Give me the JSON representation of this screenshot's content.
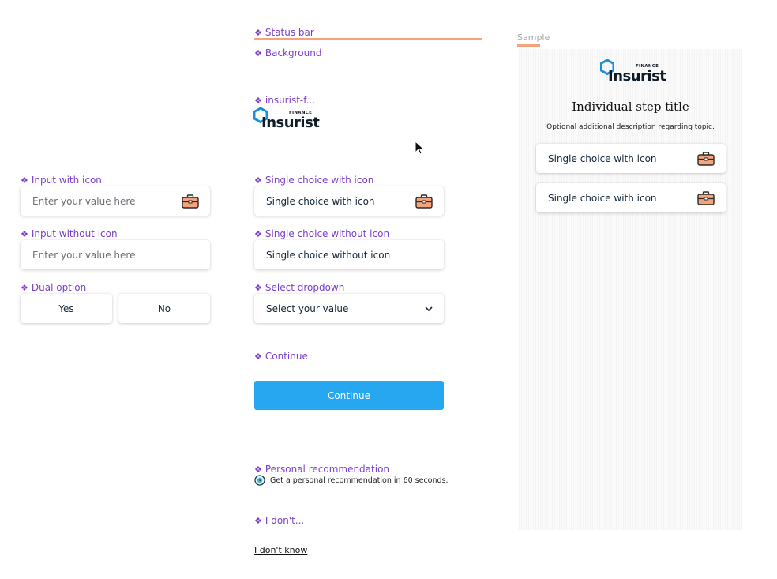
{
  "labels": {
    "status_bar": "Status bar",
    "background": "Background",
    "logo_component": "insurist-f...",
    "input_with_icon": "Input with icon",
    "input_without_icon": "Input without icon",
    "dual_option": "Dual option",
    "single_choice_with_icon": "Single choice with icon",
    "single_choice_without_icon": "Single choice without icon",
    "select_dropdown": "Select dropdown",
    "continue": "Continue",
    "personal_recommendation": "Personal recommendation",
    "i_dont": "I don't..."
  },
  "logo": {
    "word": "Insurist",
    "tag": "FINANCE"
  },
  "inputs": {
    "with_icon_placeholder": "Enter your value here",
    "without_icon_placeholder": "Enter your value here"
  },
  "dual": {
    "yes": "Yes",
    "no": "No"
  },
  "choices": {
    "with_icon": "Single choice with icon",
    "without_icon": "Single choice without icon"
  },
  "select": {
    "value": "Select your value"
  },
  "continue_button": "Continue",
  "recommendation": {
    "text": "Get a personal recommendation in 60 seconds."
  },
  "dont_know": "I don't know",
  "sample": {
    "label": "Sample",
    "title": "Individual step title",
    "description": "Optional additional description regarding topic.",
    "options": [
      "Single choice with icon",
      "Single choice with icon"
    ]
  },
  "colors": {
    "accent": "#26a7f0",
    "component_label": "#7a3fc9",
    "status_bar": "#f6a27d",
    "briefcase": "#f3a47a"
  },
  "icons": [
    "component-diamond-icon",
    "briefcase-icon",
    "chevron-down-icon",
    "shield-logo-icon",
    "clock-badge-icon",
    "mouse-cursor-icon"
  ]
}
